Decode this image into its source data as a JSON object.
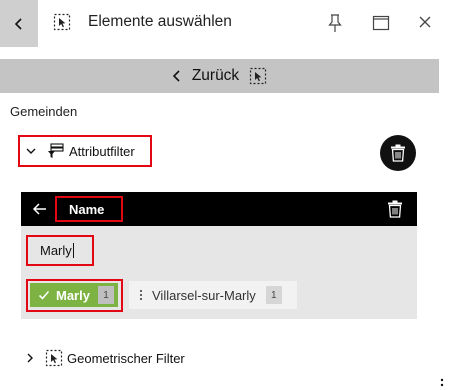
{
  "window": {
    "title": "Elemente auswählen"
  },
  "nav": {
    "back_label": "Zurück"
  },
  "section": {
    "title": "Gemeinden"
  },
  "attribute_filter": {
    "label": "Attributfilter",
    "field_name": "Name",
    "search_value": "Marly",
    "values": [
      {
        "label": "Marly",
        "count": "1",
        "selected": true
      },
      {
        "label": "Villarsel-sur-Marly",
        "count": "1",
        "selected": false
      }
    ]
  },
  "geometric_filter": {
    "label": "Geometrischer Filter"
  },
  "colors": {
    "highlight_border": "#e30613",
    "selected_chip": "#7cb342",
    "panel_header": "#000000",
    "panel_bg": "#e6e6e6",
    "nav_bar": "#c4c4c4"
  },
  "icons": {
    "back": "chevron-left-icon",
    "select": "select-dashed-icon",
    "pin": "pin-icon",
    "maximize": "maximize-icon",
    "close": "close-icon",
    "trash": "trash-icon",
    "filter": "filter-icon"
  }
}
